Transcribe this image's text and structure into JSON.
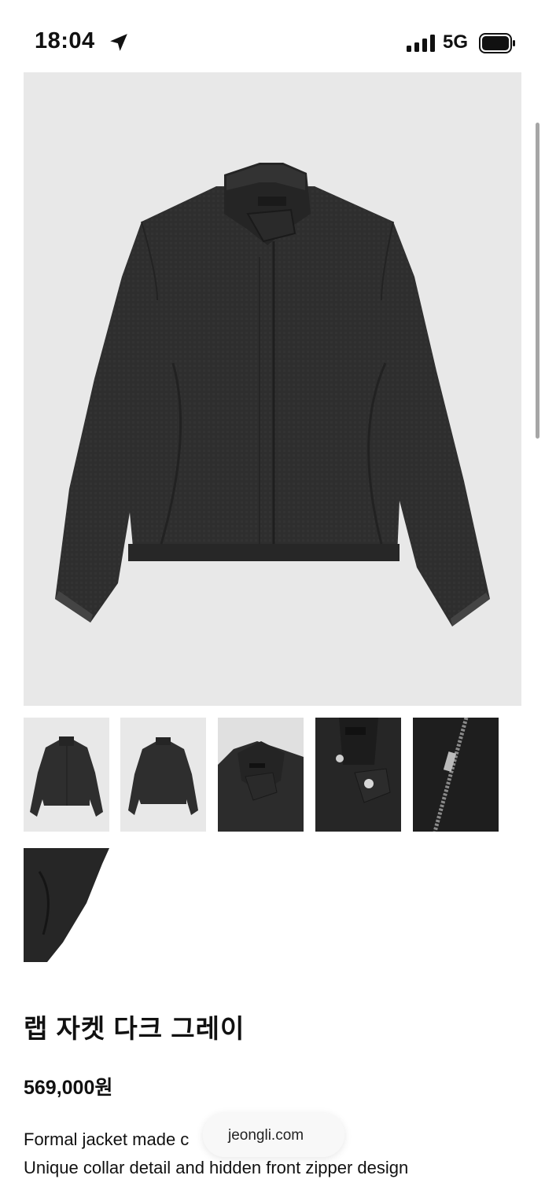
{
  "status_bar": {
    "time": "18:04",
    "network": "5G",
    "icons": [
      "location-arrow-icon",
      "signal-bars-icon",
      "battery-icon"
    ]
  },
  "product": {
    "title": "랩 자켓 다크 그레이",
    "price": "569,000원",
    "description_lines": [
      "Formal jacket made c",
      "Unique collar detail and hidden front zipper design"
    ],
    "main_image_alt": "dark gray cropped jacket",
    "thumbnails": [
      "front view",
      "back view",
      "collar detail",
      "snap button detail",
      "zipper detail",
      "hem detail"
    ]
  },
  "browser": {
    "domain": "jeongli.com"
  },
  "colors": {
    "background": "#ffffff",
    "image_background": "#e8e8e8",
    "jacket": "#2d2d2d",
    "text": "#111111"
  }
}
